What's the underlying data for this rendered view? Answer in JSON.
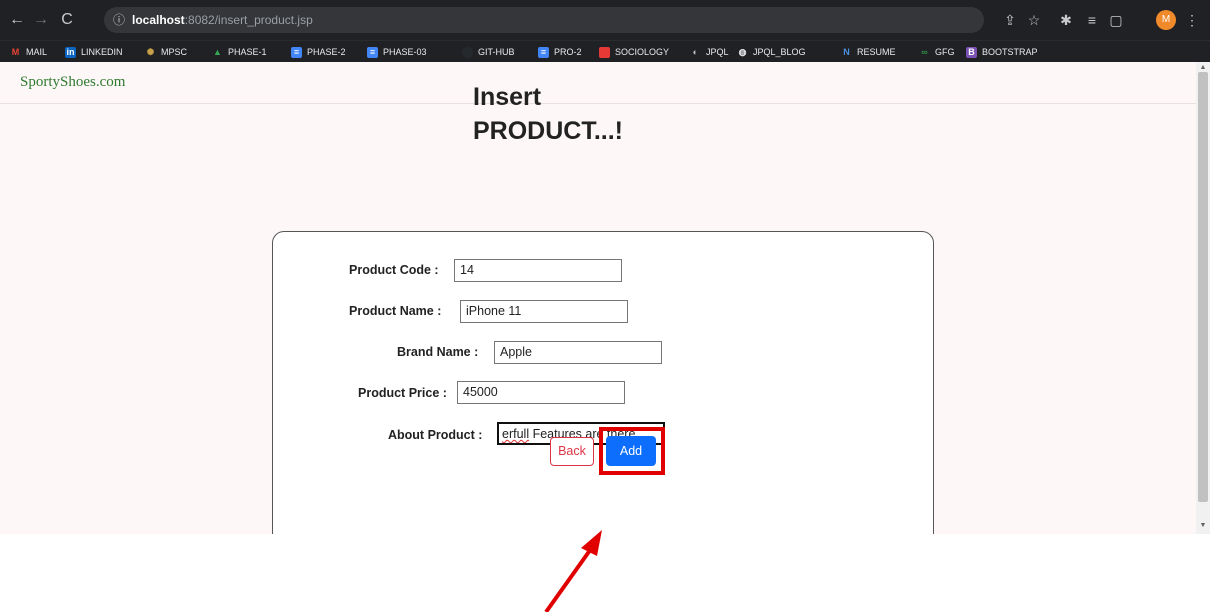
{
  "browser": {
    "url_prefix": "ⓘ",
    "url_host": "localhost",
    "url_path": ":8082/insert_product.jsp",
    "profile_initial": "M",
    "bookmarks": [
      {
        "label": "MAIL",
        "icon": "gmail-icon",
        "color": "#ea4335",
        "glyph": "M"
      },
      {
        "label": "LINKEDIN",
        "icon": "linkedin-icon",
        "color": "#0a66c2",
        "glyph": "in"
      },
      {
        "label": "MPSC",
        "icon": "mpsc-icon",
        "color": "#caa24a",
        "glyph": "✺"
      },
      {
        "label": "PHASE-1",
        "icon": "drive-icon",
        "color": "#34a853",
        "glyph": "▲"
      },
      {
        "label": "PHASE-2",
        "icon": "docs-icon",
        "color": "#4285f4",
        "glyph": "≡"
      },
      {
        "label": "PHASE-03",
        "icon": "docs-icon",
        "color": "#4285f4",
        "glyph": "≡"
      },
      {
        "label": "GIT-HUB",
        "icon": "github-icon",
        "color": "#24292e",
        "glyph": "●"
      },
      {
        "label": "PRO-2",
        "icon": "docs-icon",
        "color": "#4285f4",
        "glyph": "≡"
      },
      {
        "label": "SOCIOLOGY",
        "icon": "sociology-icon",
        "color": "#e53935",
        "glyph": "◉"
      },
      {
        "label": "JPQL",
        "icon": "jpql-icon",
        "color": "#9aa0a6",
        "glyph": "◐"
      },
      {
        "label": "JPQL_BLOG",
        "icon": "globe-icon",
        "color": "#e8eaed",
        "glyph": "◍"
      },
      {
        "label": "RESUME",
        "icon": "resume-icon",
        "color": "#4a90e2",
        "glyph": "N"
      },
      {
        "label": "GFG",
        "icon": "gfg-icon",
        "color": "#2f8d46",
        "glyph": "∞"
      },
      {
        "label": "BOOTSTRAP",
        "icon": "bootstrap-icon",
        "color": "#7952b3",
        "glyph": "B"
      }
    ]
  },
  "navbar": {
    "brand": "SportyShoes.com"
  },
  "page": {
    "title_line1": "Insert",
    "title_line2": "PRODUCT...!"
  },
  "form": {
    "product_code_label": "Product Code :",
    "product_code_value": "14",
    "product_name_label": "Product Name :",
    "product_name_value": "iPhone 11",
    "brand_name_label": "Brand Name :",
    "brand_name_value": "Apple",
    "product_price_label": "Product Price :",
    "product_price_value": "45000",
    "about_product_label": "About Product :",
    "about_product_value_prefix": "erfull",
    "about_product_value_rest": " Features are there...",
    "back_label": "Back",
    "add_label": "Add"
  },
  "colors": {
    "brand_green": "#2f7a2f",
    "add_blue": "#0d6efd",
    "back_red": "#dc3545",
    "annotation_red": "#e00000"
  }
}
